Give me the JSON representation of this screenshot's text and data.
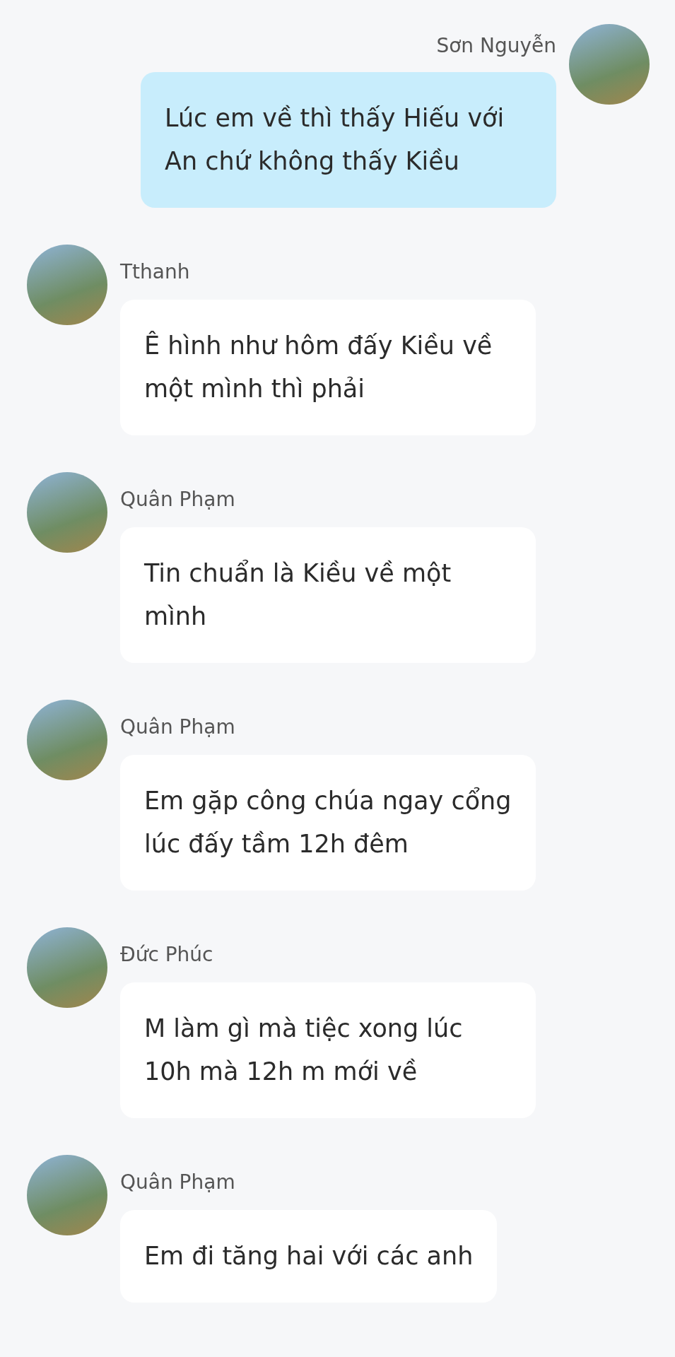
{
  "messages": [
    {
      "kind": "outgoing",
      "sender": "Sơn Nguyễn",
      "text": "Lúc em về thì thấy Hiếu với An chứ không thấy Kiều"
    },
    {
      "kind": "incoming",
      "sender": "Tthanh",
      "text": "Ê hình như hôm đấy Kiều về một mình thì phải"
    },
    {
      "kind": "incoming",
      "sender": "Quân Phạm",
      "text": "Tin chuẩn là Kiều về một mình"
    },
    {
      "kind": "incoming",
      "sender": "Quân Phạm",
      "text": "Em gặp công chúa ngay cổng lúc đấy tầm 12h đêm"
    },
    {
      "kind": "incoming",
      "sender": "Đức Phúc",
      "text": "M làm gì mà tiệc xong lúc 10h mà 12h m mới về"
    },
    {
      "kind": "incoming",
      "sender": "Quân Phạm",
      "text": "Em đi tăng hai với các anh"
    }
  ]
}
